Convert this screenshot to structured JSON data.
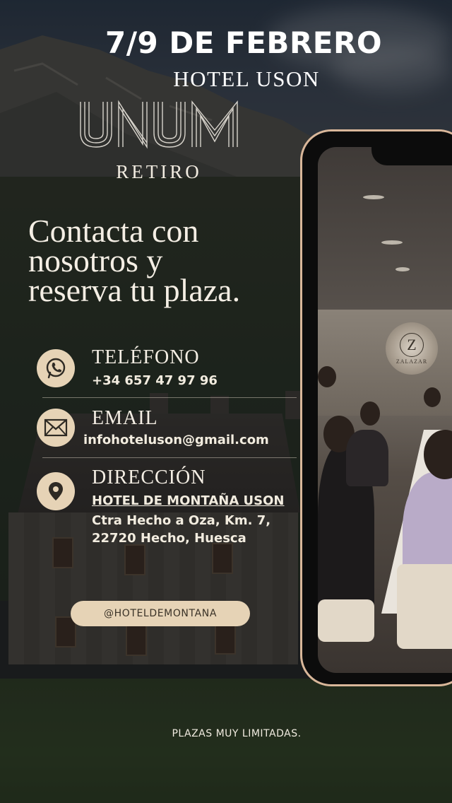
{
  "event": {
    "date": "7/9 DE FEBRERO",
    "venue": "HOTEL USON"
  },
  "logo": {
    "name": "UNUM",
    "subtitle": "RETIRO"
  },
  "headline": {
    "lines": [
      "Contacta con",
      "nosotros y",
      "reserva tu plaza."
    ]
  },
  "contacts": {
    "phone": {
      "label": "TELÉFONO",
      "value": "+34 657 47 97 96",
      "icon": "whatsapp-icon"
    },
    "email": {
      "label": "EMAIL",
      "value": "infohoteluson@gmail.com",
      "icon": "mail-icon"
    },
    "address": {
      "label": "DIRECCIÓN",
      "name": "HOTEL DE MONTAÑA USON",
      "line1": "Ctra Hecho a Oza, Km. 7,",
      "line2": "22720 Hecho, Huesca",
      "icon": "location-pin-icon"
    }
  },
  "social": {
    "handle": "@HOTELDEMONTANA"
  },
  "footer": {
    "note": "PLAZAS MUY LIMITADAS."
  },
  "phone_mockup": {
    "sign_letter": "Z",
    "sign_brand": "ZALAZAR"
  },
  "colors": {
    "accent": "#e6d3b6",
    "phone_frame": "#d9b79a",
    "text": "#f4eee4"
  }
}
